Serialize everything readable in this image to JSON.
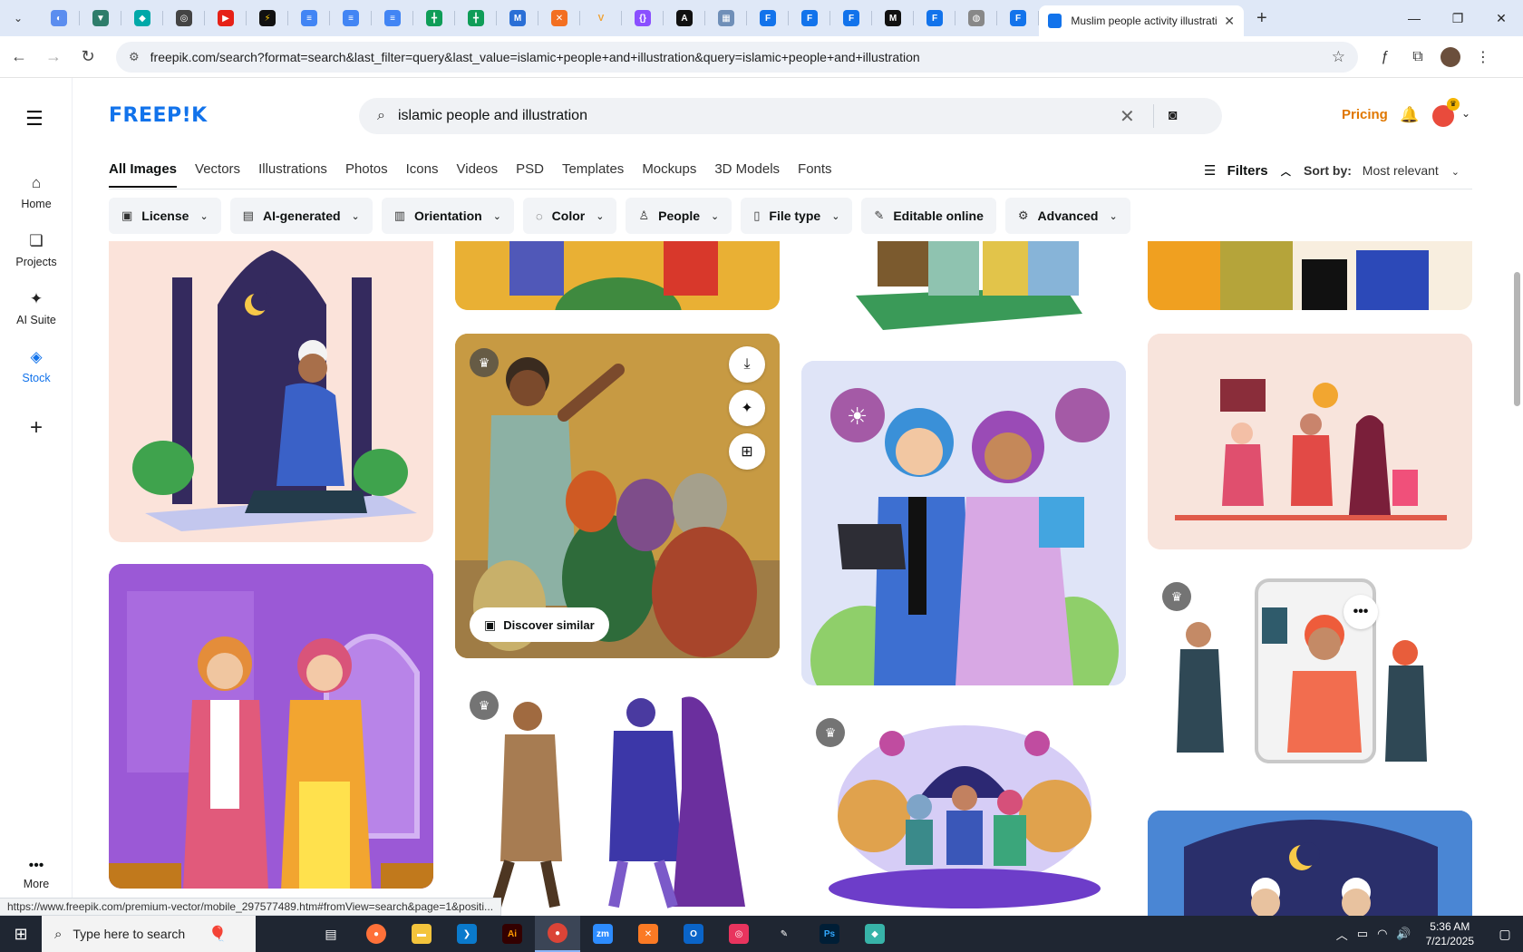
{
  "browser": {
    "active_tab_title": "Muslim people activity illustrati",
    "url": "freepik.com/search?format=search&last_filter=query&last_value=islamic+people+and+illustration&query=islamic+people+and+illustration",
    "status_url": "https://www.freepik.com/premium-vector/mobile_297577489.htm#fromView=search&page=1&positi..."
  },
  "rail": {
    "items": [
      {
        "label": "Home",
        "icon": "home-icon"
      },
      {
        "label": "Projects",
        "icon": "projects-icon"
      },
      {
        "label": "AI Suite",
        "icon": "sparkle-icon"
      },
      {
        "label": "Stock",
        "icon": "stock-icon"
      }
    ],
    "more_label": "More"
  },
  "header": {
    "logo": "FREEP!K",
    "search_value": "islamic people and illustration",
    "pricing": "Pricing"
  },
  "categories": [
    "All Images",
    "Vectors",
    "Illustrations",
    "Photos",
    "Icons",
    "Videos",
    "PSD",
    "Templates",
    "Mockups",
    "3D Models",
    "Fonts"
  ],
  "filters_label": "Filters",
  "sort": {
    "label": "Sort by:",
    "value": "Most relevant"
  },
  "chips": [
    "License",
    "AI-generated",
    "Orientation",
    "Color",
    "People",
    "File type",
    "Editable online",
    "Advanced"
  ],
  "card_actions": {
    "discover": "Discover similar"
  },
  "taskbar": {
    "search_placeholder": "Type here to search",
    "time": "5:36 AM",
    "date": "7/21/2025"
  },
  "colors": {
    "brand": "#1273eb",
    "pricing": "#e07700"
  }
}
